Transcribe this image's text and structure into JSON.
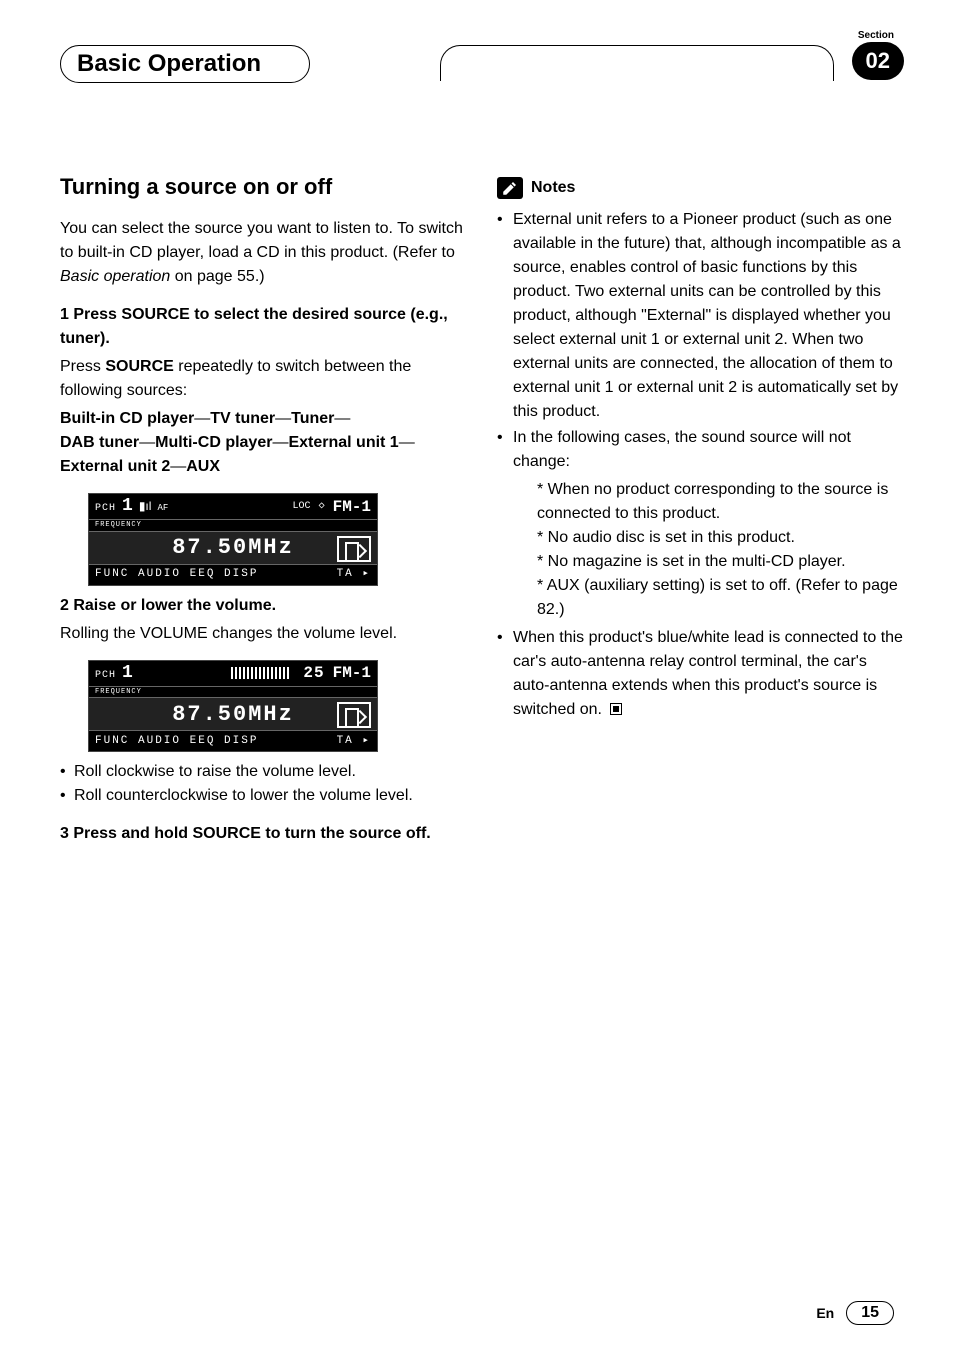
{
  "header": {
    "section_label": "Section",
    "tab_title": "Basic Operation",
    "section_number": "02"
  },
  "left": {
    "heading": "Turning a source on or off",
    "intro": "You can select the source you want to listen to. To switch to built-in CD player, load a CD in this product. (Refer to ",
    "intro_ref": "Basic operation",
    "intro_suffix": " on page 55.)",
    "step1_a": "1   Press ",
    "step1_src": "SOURCE",
    "step1_b": " to select the desired source (e.g., tuner).",
    "step1_body_a": "Press ",
    "step1_body_src": "SOURCE",
    "step1_body_b": " repeatedly to switch between the following sources:",
    "chain": [
      "Built-in CD player",
      "TV tuner",
      "Tuner",
      "DAB tuner",
      "Multi-CD player",
      "External unit 1",
      "External unit 2",
      "AUX"
    ],
    "display1": {
      "pch_label": "PCH",
      "pch_num": "1",
      "freq_label": "FREQUENCY",
      "af": "AF",
      "loc": "LOC",
      "stereo": "◇",
      "band": "FM-1",
      "freq": "87.50MHz",
      "bottom_left": "FUNC  AUDIO  EEQ  DISP",
      "bottom_right": "TA  ▸"
    },
    "step2": "2   Raise or lower the volume.",
    "step2_body": "Rolling the VOLUME changes the volume level.",
    "display2": {
      "pch_label": "PCH",
      "pch_num": "1",
      "freq_label": "FREQUENCY",
      "vol": "25",
      "band": "FM-1",
      "freq": "87.50MHz",
      "bottom_left": "FUNC  AUDIO  EEQ  DISP",
      "bottom_right": "TA  ▸"
    },
    "roll_cw": "Roll clockwise to raise the volume level.",
    "roll_ccw": "Roll counterclockwise to lower the volume level.",
    "step3_a": "3   Press and hold ",
    "step3_src": "SOURCE",
    "step3_b": " to turn the source off."
  },
  "right": {
    "notes_label": "Notes",
    "note1": "External unit refers to a Pioneer product (such as one available in the future) that, although incompatible as a source, enables control of basic functions by this product. Two external units can be controlled by this product, although \"External\" is displayed whether you select external unit 1 or external unit 2. When two external units are connected, the allocation of them to external unit 1 or external unit 2 is automatically set by this product.",
    "note2_lead": "In the following cases, the sound source will not change:",
    "note2_items": [
      "When no product corresponding to the source is connected to this product.",
      "No audio disc is set in this product.",
      "No magazine is set in the multi-CD player.",
      "AUX (auxiliary setting) is set to off. (Refer to page 82.)"
    ],
    "note3": "When this product's blue/white lead is connected to the car's auto-antenna relay control terminal, the car's auto-antenna extends when this product's source is switched on."
  },
  "footer": {
    "lang": "En",
    "page": "15"
  }
}
